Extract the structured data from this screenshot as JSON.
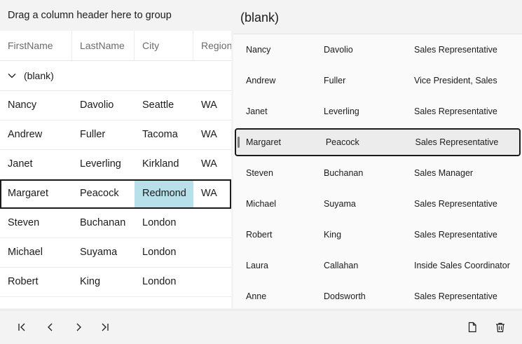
{
  "grid": {
    "group_panel_text": "Drag a column header here to group",
    "columns": [
      "FirstName",
      "LastName",
      "City",
      "Region"
    ],
    "group_label": "(blank)",
    "rows": [
      {
        "first": "Nancy",
        "last": "Davolio",
        "city": "Seattle",
        "region": "WA"
      },
      {
        "first": "Andrew",
        "last": "Fuller",
        "city": "Tacoma",
        "region": "WA"
      },
      {
        "first": "Janet",
        "last": "Leverling",
        "city": "Kirkland",
        "region": "WA"
      },
      {
        "first": "Margaret",
        "last": "Peacock",
        "city": "Redmond",
        "region": "WA"
      },
      {
        "first": "Steven",
        "last": "Buchanan",
        "city": "London",
        "region": ""
      },
      {
        "first": "Michael",
        "last": "Suyama",
        "city": "London",
        "region": ""
      },
      {
        "first": "Robert",
        "last": "King",
        "city": "London",
        "region": ""
      }
    ],
    "selected_row": 3,
    "current_column": "city"
  },
  "detail": {
    "title": "(blank)",
    "rows": [
      {
        "first": "Nancy",
        "last": "Davolio",
        "title": "Sales Representative"
      },
      {
        "first": "Andrew",
        "last": "Fuller",
        "title": "Vice President, Sales"
      },
      {
        "first": "Janet",
        "last": "Leverling",
        "title": "Sales Representative"
      },
      {
        "first": "Margaret",
        "last": "Peacock",
        "title": "Sales Representative"
      },
      {
        "first": "Steven",
        "last": "Buchanan",
        "title": "Sales Manager"
      },
      {
        "first": "Michael",
        "last": "Suyama",
        "title": "Sales Representative"
      },
      {
        "first": "Robert",
        "last": "King",
        "title": "Sales Representative"
      },
      {
        "first": "Laura",
        "last": "Callahan",
        "title": "Inside Sales Coordinator"
      },
      {
        "first": "Anne",
        "last": "Dodsworth",
        "title": "Sales Representative"
      }
    ],
    "selected_row": 3
  },
  "toolbar": {
    "icons": [
      "first-page-icon",
      "previous-page-icon",
      "next-page-icon",
      "last-page-icon",
      "new-document-icon",
      "delete-icon"
    ]
  }
}
